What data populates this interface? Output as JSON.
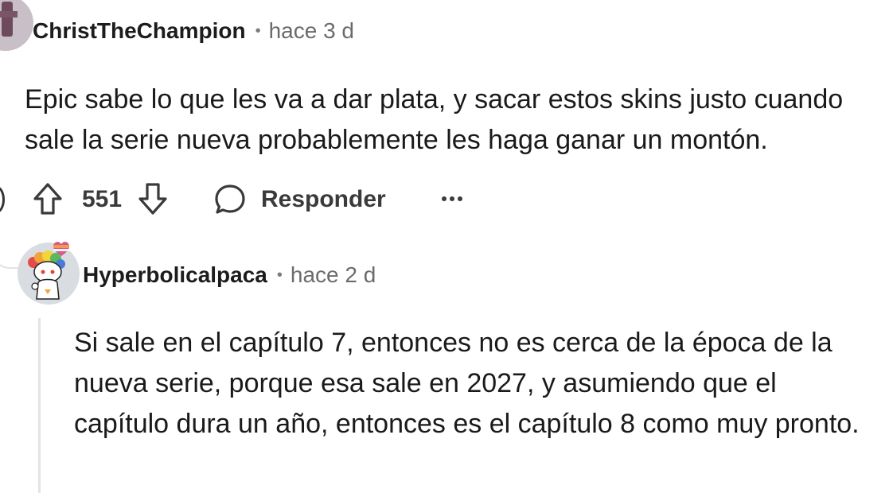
{
  "comments": [
    {
      "author": "ChristTheChampion",
      "separator": "•",
      "time": "hace 3 d",
      "body": "Epic sabe lo que les va a dar plata, y sacar estos skins justo cuando sale la serie nueva probablemente les haga ganar un montón.",
      "score": "551",
      "reply_label": "Responder",
      "more_label": "···",
      "avatar_icon": "user-avatar-icon",
      "upvote_icon": "arrow-up-icon",
      "downvote_icon": "arrow-down-icon",
      "reply_icon": "speech-bubble-icon"
    },
    {
      "author": "Hyperbolicalpaca",
      "separator": "•",
      "time": "hace 2 d",
      "body": "Si sale en el capítulo 7, entonces no es cerca de la época de la nueva serie, porque esa sale en 2027, y asumiendo que el capítulo dura un año, entonces es el capítulo 8 como muy pronto.",
      "avatar_icon": "snoo-avatar-icon"
    }
  ],
  "colors": {
    "username": "#1c1c1c",
    "meta": "#6b6b6b",
    "action": "#3a3a3a",
    "thread_line": "#e3e3e3"
  }
}
